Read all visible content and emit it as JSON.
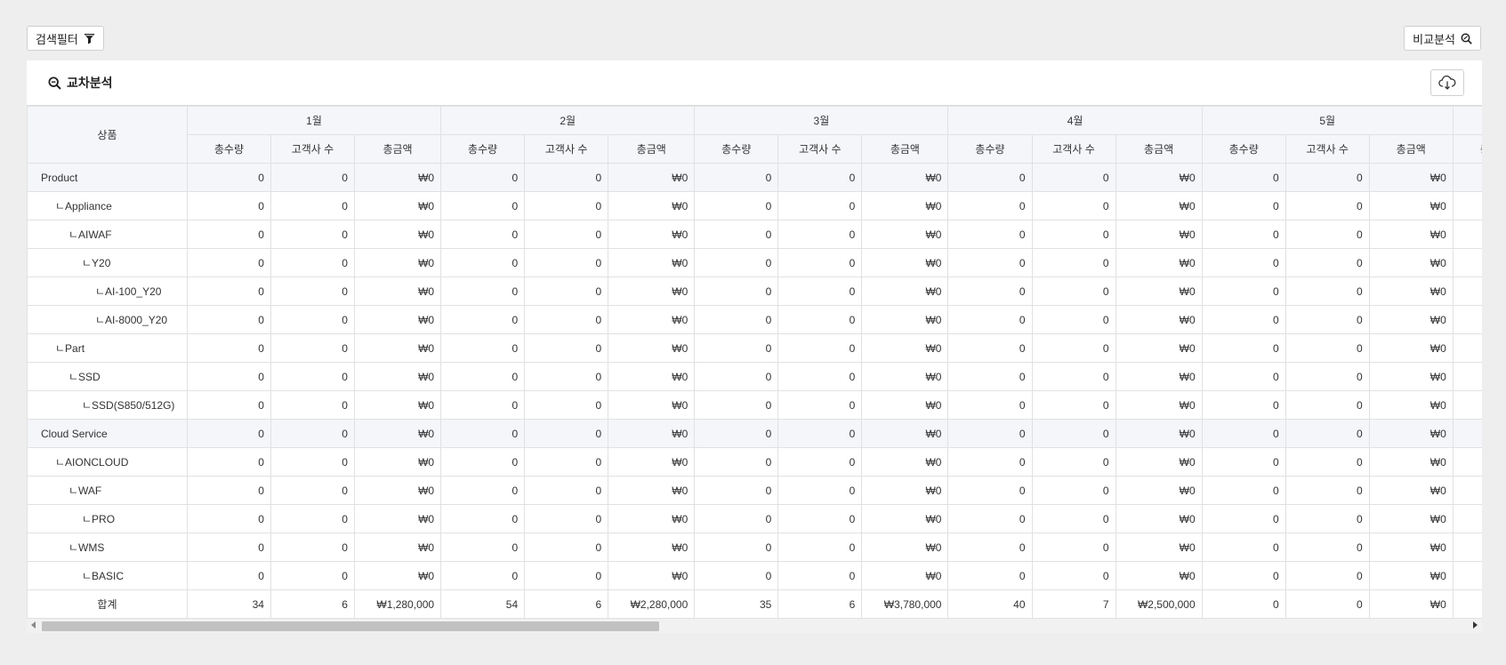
{
  "toolbar": {
    "filter_label": "검색필터",
    "compare_label": "비교분석"
  },
  "panel": {
    "title": "교차분석"
  },
  "table": {
    "product_header": "상품",
    "months": [
      "1월",
      "2월",
      "3월",
      "4월",
      "5월"
    ],
    "sub_headers": [
      "총수량",
      "고객사 수",
      "총금액"
    ],
    "partial_sub_header": "총수량",
    "rows": [
      {
        "name": "Product",
        "level": "top",
        "values": [
          "0",
          "0",
          "₩0",
          "0",
          "0",
          "₩0",
          "0",
          "0",
          "₩0",
          "0",
          "0",
          "₩0",
          "0",
          "0",
          "₩0"
        ]
      },
      {
        "name": "ㄴAppliance",
        "level": "1",
        "values": [
          "0",
          "0",
          "₩0",
          "0",
          "0",
          "₩0",
          "0",
          "0",
          "₩0",
          "0",
          "0",
          "₩0",
          "0",
          "0",
          "₩0"
        ]
      },
      {
        "name": "ㄴAIWAF",
        "level": "2",
        "values": [
          "0",
          "0",
          "₩0",
          "0",
          "0",
          "₩0",
          "0",
          "0",
          "₩0",
          "0",
          "0",
          "₩0",
          "0",
          "0",
          "₩0"
        ]
      },
      {
        "name": "ㄴY20",
        "level": "3",
        "values": [
          "0",
          "0",
          "₩0",
          "0",
          "0",
          "₩0",
          "0",
          "0",
          "₩0",
          "0",
          "0",
          "₩0",
          "0",
          "0",
          "₩0"
        ]
      },
      {
        "name": "ㄴAI-100_Y20",
        "level": "4",
        "values": [
          "0",
          "0",
          "₩0",
          "0",
          "0",
          "₩0",
          "0",
          "0",
          "₩0",
          "0",
          "0",
          "₩0",
          "0",
          "0",
          "₩0"
        ]
      },
      {
        "name": "ㄴAI-8000_Y20",
        "level": "4",
        "values": [
          "0",
          "0",
          "₩0",
          "0",
          "0",
          "₩0",
          "0",
          "0",
          "₩0",
          "0",
          "0",
          "₩0",
          "0",
          "0",
          "₩0"
        ]
      },
      {
        "name": "ㄴPart",
        "level": "1",
        "values": [
          "0",
          "0",
          "₩0",
          "0",
          "0",
          "₩0",
          "0",
          "0",
          "₩0",
          "0",
          "0",
          "₩0",
          "0",
          "0",
          "₩0"
        ]
      },
      {
        "name": "ㄴSSD",
        "level": "2",
        "values": [
          "0",
          "0",
          "₩0",
          "0",
          "0",
          "₩0",
          "0",
          "0",
          "₩0",
          "0",
          "0",
          "₩0",
          "0",
          "0",
          "₩0"
        ]
      },
      {
        "name": "ㄴSSD(S850/512G)",
        "level": "3",
        "values": [
          "0",
          "0",
          "₩0",
          "0",
          "0",
          "₩0",
          "0",
          "0",
          "₩0",
          "0",
          "0",
          "₩0",
          "0",
          "0",
          "₩0"
        ]
      },
      {
        "name": "Cloud Service",
        "level": "top",
        "values": [
          "0",
          "0",
          "₩0",
          "0",
          "0",
          "₩0",
          "0",
          "0",
          "₩0",
          "0",
          "0",
          "₩0",
          "0",
          "0",
          "₩0"
        ]
      },
      {
        "name": "ㄴAIONCLOUD",
        "level": "1",
        "values": [
          "0",
          "0",
          "₩0",
          "0",
          "0",
          "₩0",
          "0",
          "0",
          "₩0",
          "0",
          "0",
          "₩0",
          "0",
          "0",
          "₩0"
        ]
      },
      {
        "name": "ㄴWAF",
        "level": "2",
        "values": [
          "0",
          "0",
          "₩0",
          "0",
          "0",
          "₩0",
          "0",
          "0",
          "₩0",
          "0",
          "0",
          "₩0",
          "0",
          "0",
          "₩0"
        ]
      },
      {
        "name": "ㄴPRO",
        "level": "3",
        "values": [
          "0",
          "0",
          "₩0",
          "0",
          "0",
          "₩0",
          "0",
          "0",
          "₩0",
          "0",
          "0",
          "₩0",
          "0",
          "0",
          "₩0"
        ]
      },
      {
        "name": "ㄴWMS",
        "level": "2",
        "values": [
          "0",
          "0",
          "₩0",
          "0",
          "0",
          "₩0",
          "0",
          "0",
          "₩0",
          "0",
          "0",
          "₩0",
          "0",
          "0",
          "₩0"
        ]
      },
      {
        "name": "ㄴBASIC",
        "level": "3",
        "values": [
          "0",
          "0",
          "₩0",
          "0",
          "0",
          "₩0",
          "0",
          "0",
          "₩0",
          "0",
          "0",
          "₩0",
          "0",
          "0",
          "₩0"
        ]
      }
    ],
    "total": {
      "name": "합계",
      "values": [
        "34",
        "6",
        "₩1,280,000",
        "54",
        "6",
        "₩2,280,000",
        "35",
        "6",
        "₩3,780,000",
        "40",
        "7",
        "₩2,500,000",
        "0",
        "0",
        "₩0"
      ]
    }
  },
  "colors": {
    "header_bg": "#f4f6fa",
    "border": "#e1e1e1",
    "page_bg": "#eeeeee"
  }
}
